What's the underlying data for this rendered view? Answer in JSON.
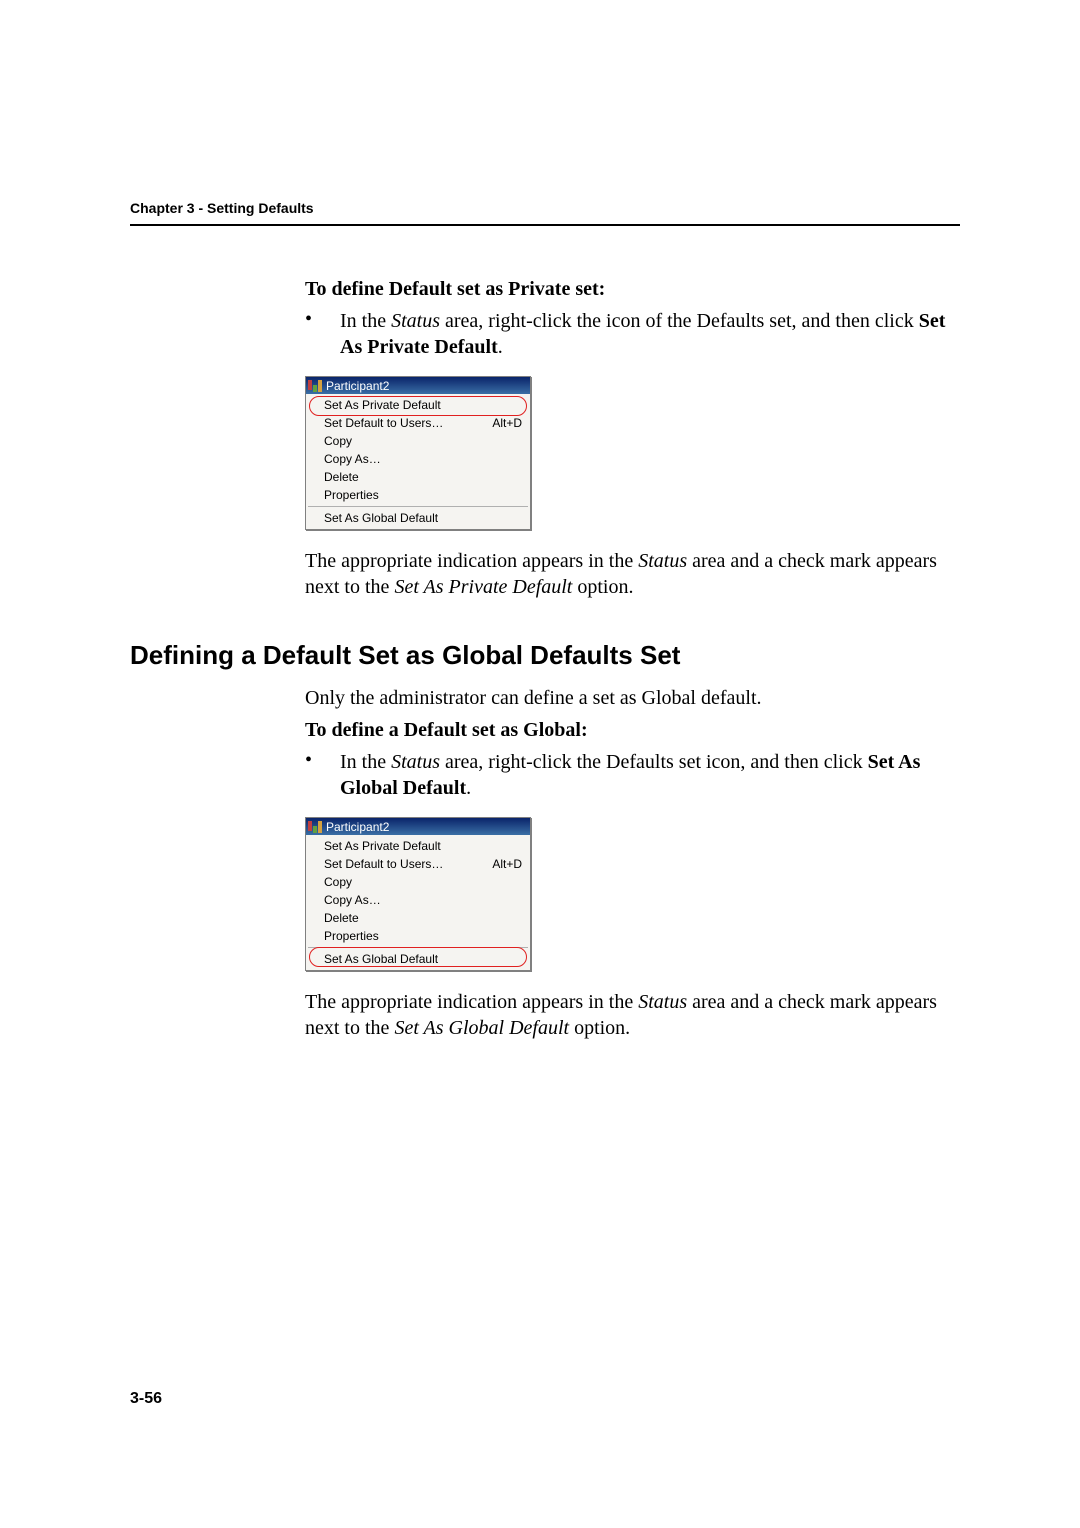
{
  "header": {
    "text": "Chapter 3 - Setting Defaults"
  },
  "section1": {
    "lead": "To define Default set as Private set:",
    "bullet_pre": "In the ",
    "bullet_status": "Status",
    "bullet_mid": " area, right-click the icon of the Defaults set, and then click ",
    "bullet_bold": "Set As Private Default",
    "bullet_post": ".",
    "result_pre": "The appropriate indication appears in the ",
    "result_status": "Status",
    "result_mid": " area and a check mark appears next to the ",
    "result_em": "Set As Private Default",
    "result_post": " option."
  },
  "heading2": "Defining a Default Set as Global Defaults Set",
  "section2": {
    "intro": "Only the administrator can define a set as Global default.",
    "lead": "To define a Default set as Global:",
    "bullet_pre": "In the ",
    "bullet_status": "Status",
    "bullet_mid": " area, right-click the Defaults set icon, and then click ",
    "bullet_bold": "Set As Global Default",
    "bullet_post": ".",
    "result_pre": "The appropriate indication appears in the ",
    "result_status": "Status",
    "result_mid": " area and a check mark appears next to the ",
    "result_em": "Set As Global Default",
    "result_post": " option."
  },
  "menu": {
    "title": "Participant2",
    "items": {
      "priv": "Set As Private Default",
      "users": "Set Default to Users…",
      "users_accel": "Alt+D",
      "copy": "Copy",
      "copyas": "Copy As…",
      "del": "Delete",
      "props": "Properties",
      "global": "Set As Global Default"
    }
  },
  "pagenum": "3-56"
}
